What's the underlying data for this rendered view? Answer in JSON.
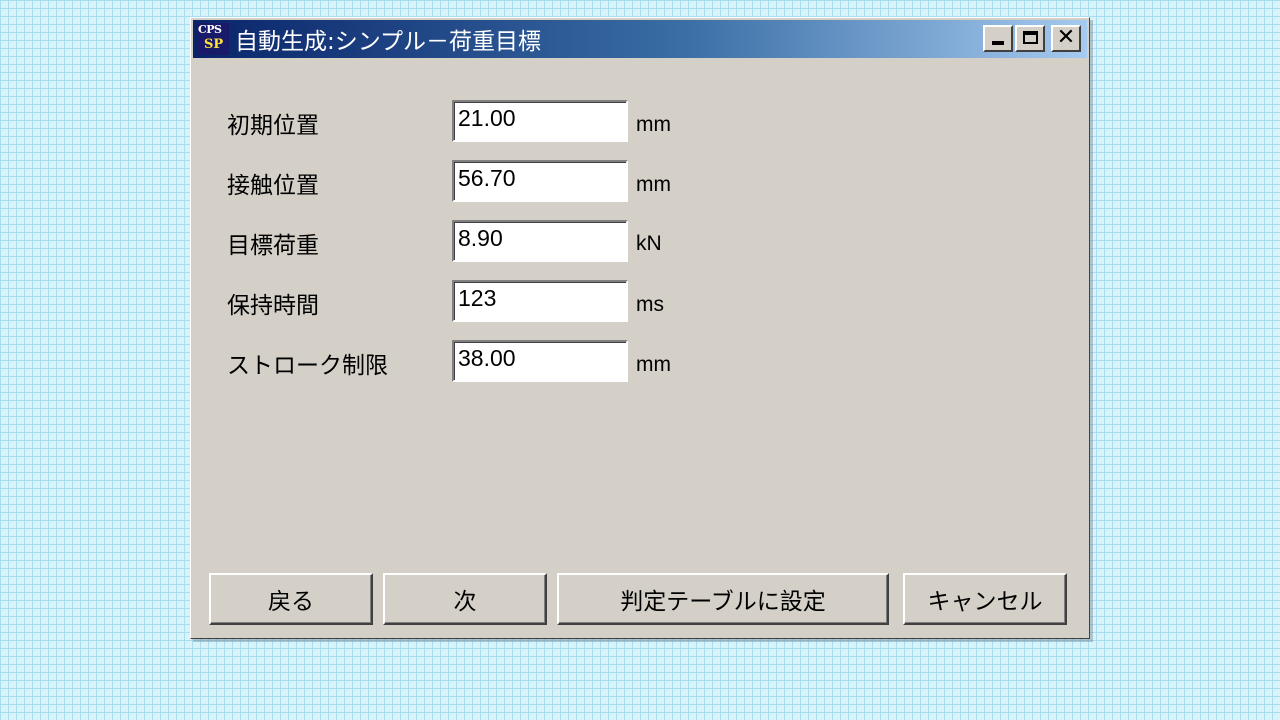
{
  "window": {
    "icon_line1": "CPS",
    "icon_line2": "SP",
    "title": "自動生成:シンプル－荷重目標"
  },
  "title_buttons": [
    "minimize-icon",
    "maximize-icon",
    "close-icon"
  ],
  "fields": [
    {
      "label": "初期位置",
      "value": "21.00",
      "unit": "mm"
    },
    {
      "label": "接触位置",
      "value": "56.70",
      "unit": "mm"
    },
    {
      "label": "目標荷重",
      "value": "8.90",
      "unit": "kN"
    },
    {
      "label": "保持時間",
      "value": "123",
      "unit": "ms"
    },
    {
      "label": "ストローク制限",
      "value": "38.00",
      "unit": "mm"
    }
  ],
  "buttons": {
    "back": "戻る",
    "next": "次",
    "set_table": "判定テーブルに設定",
    "cancel": "キャンセル"
  },
  "colors": {
    "title_gradient_start": "#0a246a",
    "title_gradient_end": "#a6caf0",
    "window_face": "#d4d0c8",
    "desktop": "#d9f3fb"
  }
}
